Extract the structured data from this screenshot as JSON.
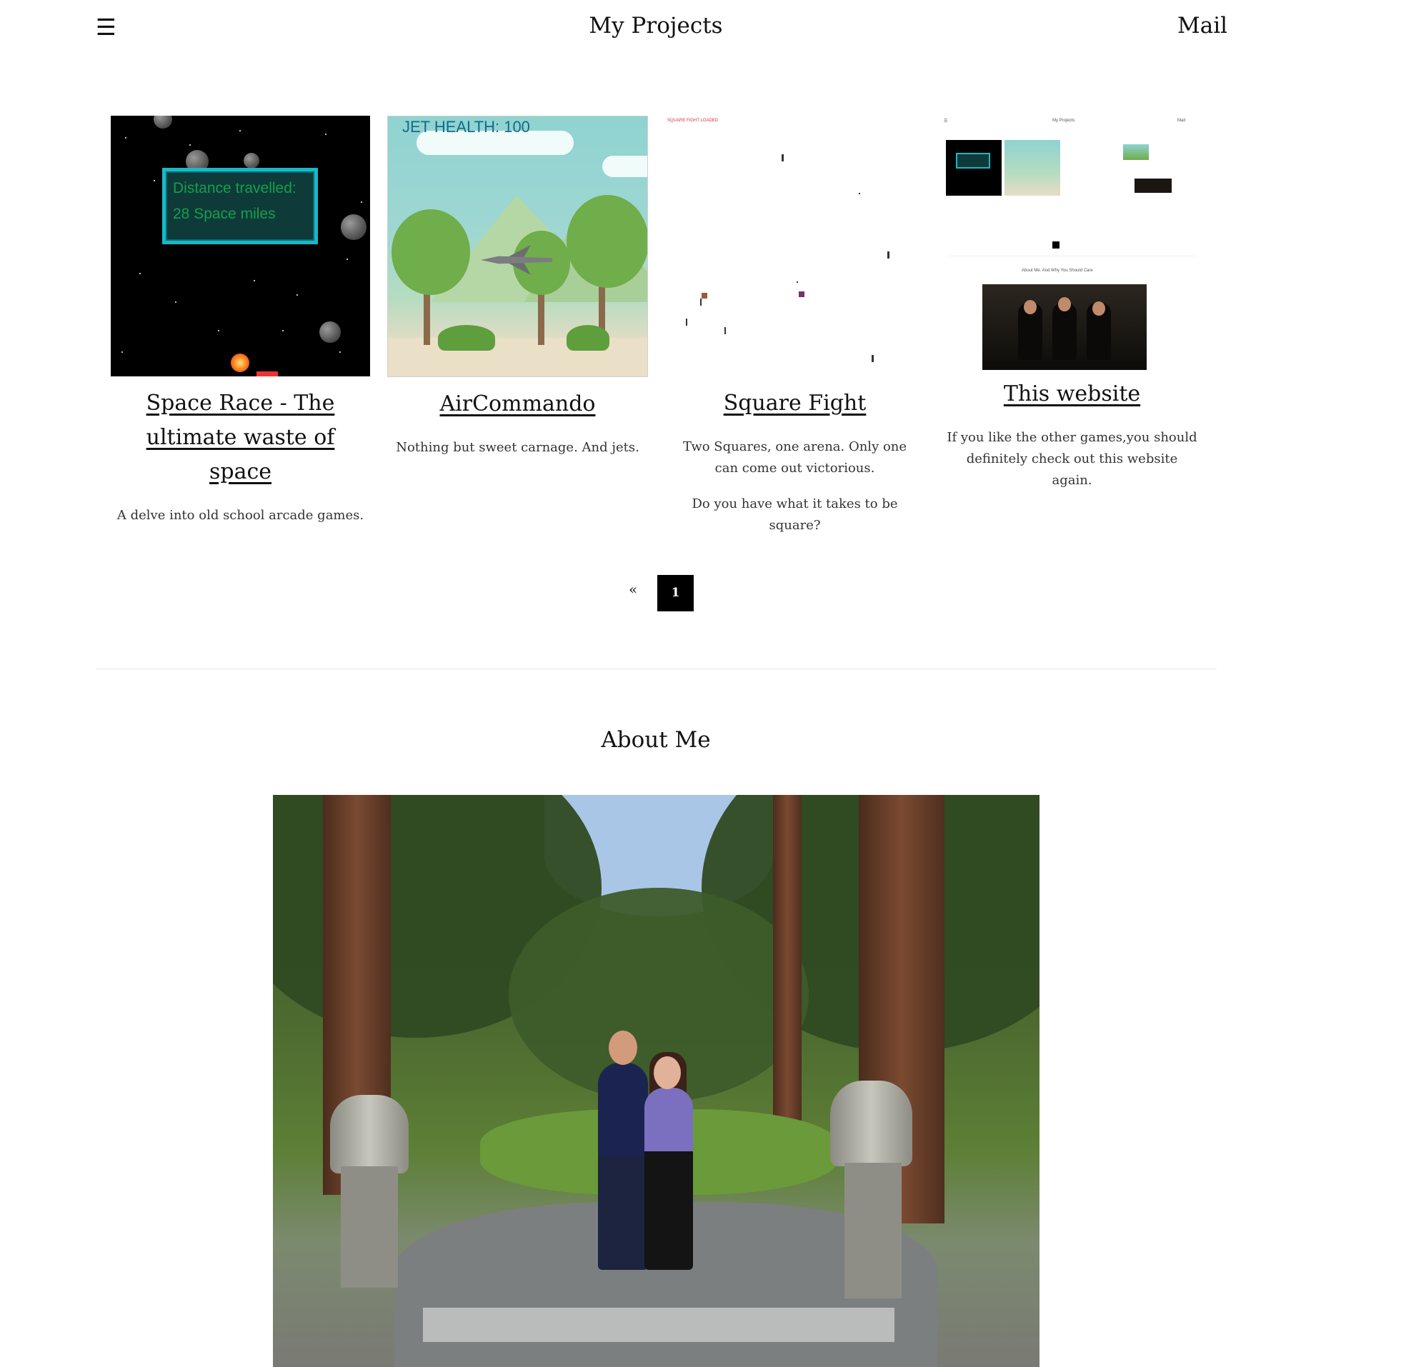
{
  "header": {
    "menu_icon": "hamburger-menu-icon",
    "title": "My Projects",
    "mail_label": "Mail"
  },
  "projects": [
    {
      "title": "Space Race - The ultimate waste of space",
      "description": [
        "A delve into old school arcade games."
      ],
      "thumbnail": {
        "hud_line1": "Distance travelled:",
        "hud_line2": "28 Space miles"
      }
    },
    {
      "title": "AirCommando",
      "description": [
        "Nothing but sweet carnage. And jets."
      ],
      "thumbnail": {
        "hud": "JET HEALTH: 100"
      }
    },
    {
      "title": "Square Fight",
      "description": [
        "Two Squares, one arena. Only one can come out victorious.",
        "Do you have what it takes to be square?"
      ],
      "thumbnail": {
        "hud": "SQUARE FIGHT LOADED"
      }
    },
    {
      "title": "This website",
      "description": [
        "If you like the other games,you should definitely check out this website again."
      ],
      "thumbnail": {
        "mini_title": "My Projects",
        "mini_mail": "Mail",
        "mini_about": "About Me. And Why You Should Care"
      }
    }
  ],
  "pagination": {
    "prev_label": "«",
    "current_page": "1"
  },
  "about": {
    "title": "About Me"
  },
  "colors": {
    "text": "#111111",
    "pager_active_bg": "#000000",
    "hud_border": "#18b8c6",
    "hud_text": "#13a04a"
  }
}
